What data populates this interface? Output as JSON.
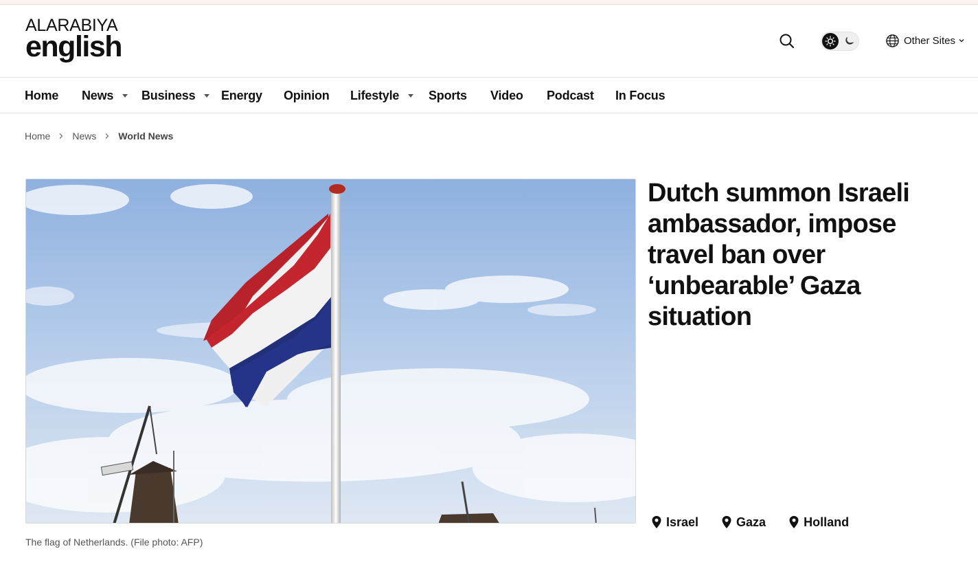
{
  "site": {
    "logo_top": "ALARABIYA",
    "logo_bottom": "english"
  },
  "header": {
    "other_sites_label": "Other Sites",
    "icons": {
      "search": "search-icon",
      "theme_light": "sun-icon",
      "theme_dark": "moon-icon",
      "globe": "globe-icon",
      "dropdown": "chevron-down-icon"
    }
  },
  "nav": {
    "items": [
      {
        "label": "Home",
        "has_dropdown": false
      },
      {
        "label": "News",
        "has_dropdown": true
      },
      {
        "label": "Business",
        "has_dropdown": true
      },
      {
        "label": "Energy",
        "has_dropdown": false
      },
      {
        "label": "Opinion",
        "has_dropdown": false
      },
      {
        "label": "Lifestyle",
        "has_dropdown": true
      },
      {
        "label": "Sports",
        "has_dropdown": false
      },
      {
        "label": "Video",
        "has_dropdown": false
      },
      {
        "label": "Podcast",
        "has_dropdown": false
      },
      {
        "label": "In Focus",
        "has_dropdown": false
      }
    ]
  },
  "breadcrumb": {
    "items": [
      "Home",
      "News",
      "World News"
    ]
  },
  "article": {
    "headline": "Dutch summon Israeli ambassador, impose travel ban over ‘unbearable’ Gaza situation",
    "image_caption": "The flag of Netherlands. (File photo: AFP)",
    "tags": [
      "Israel",
      "Gaza",
      "Holland"
    ]
  },
  "colors": {
    "text": "#111111",
    "muted": "#555555",
    "divider": "#e4e4e4",
    "top_strip": "#fdf3f1",
    "flag_red": "#b8222b",
    "flag_white": "#f2f2f2",
    "flag_blue": "#22307a",
    "sky": "#a9c4e6"
  }
}
